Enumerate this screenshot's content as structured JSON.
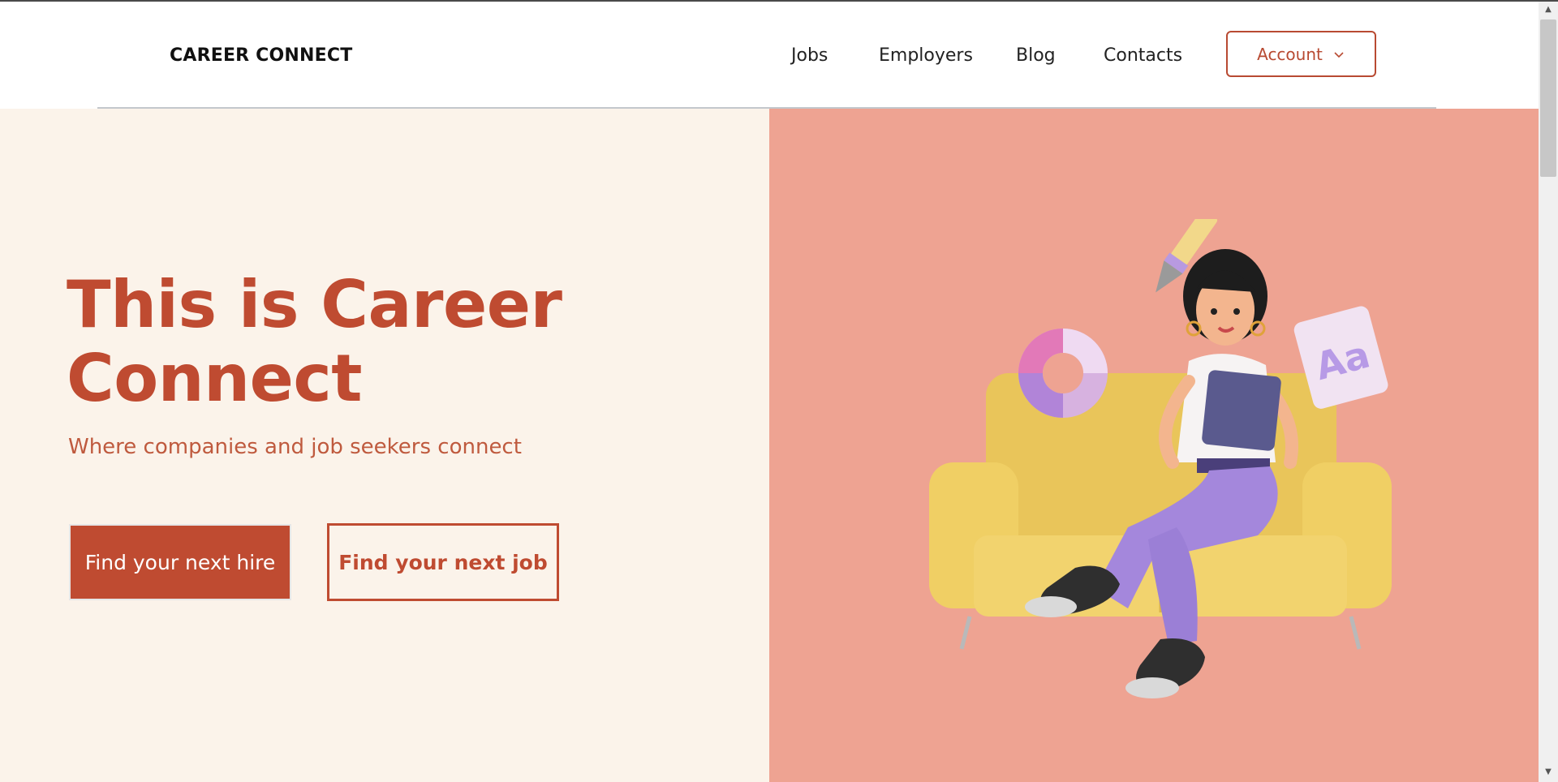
{
  "header": {
    "logo": "CAREER CONNECT",
    "nav": [
      {
        "label": "Jobs"
      },
      {
        "label": "Employers"
      },
      {
        "label": "Blog"
      },
      {
        "label": "Contacts"
      }
    ],
    "account_label": "Account"
  },
  "hero": {
    "title_line1": "This is Career",
    "title_line2": "Connect",
    "subtitle": "Where companies and job seekers connect",
    "primary_cta": "Find your next hire",
    "secondary_cta": "Find your next job",
    "illustration_text": "Aa"
  },
  "colors": {
    "accent": "#bf4b31",
    "left_bg": "#fbf3ea",
    "right_bg": "#eea392"
  }
}
